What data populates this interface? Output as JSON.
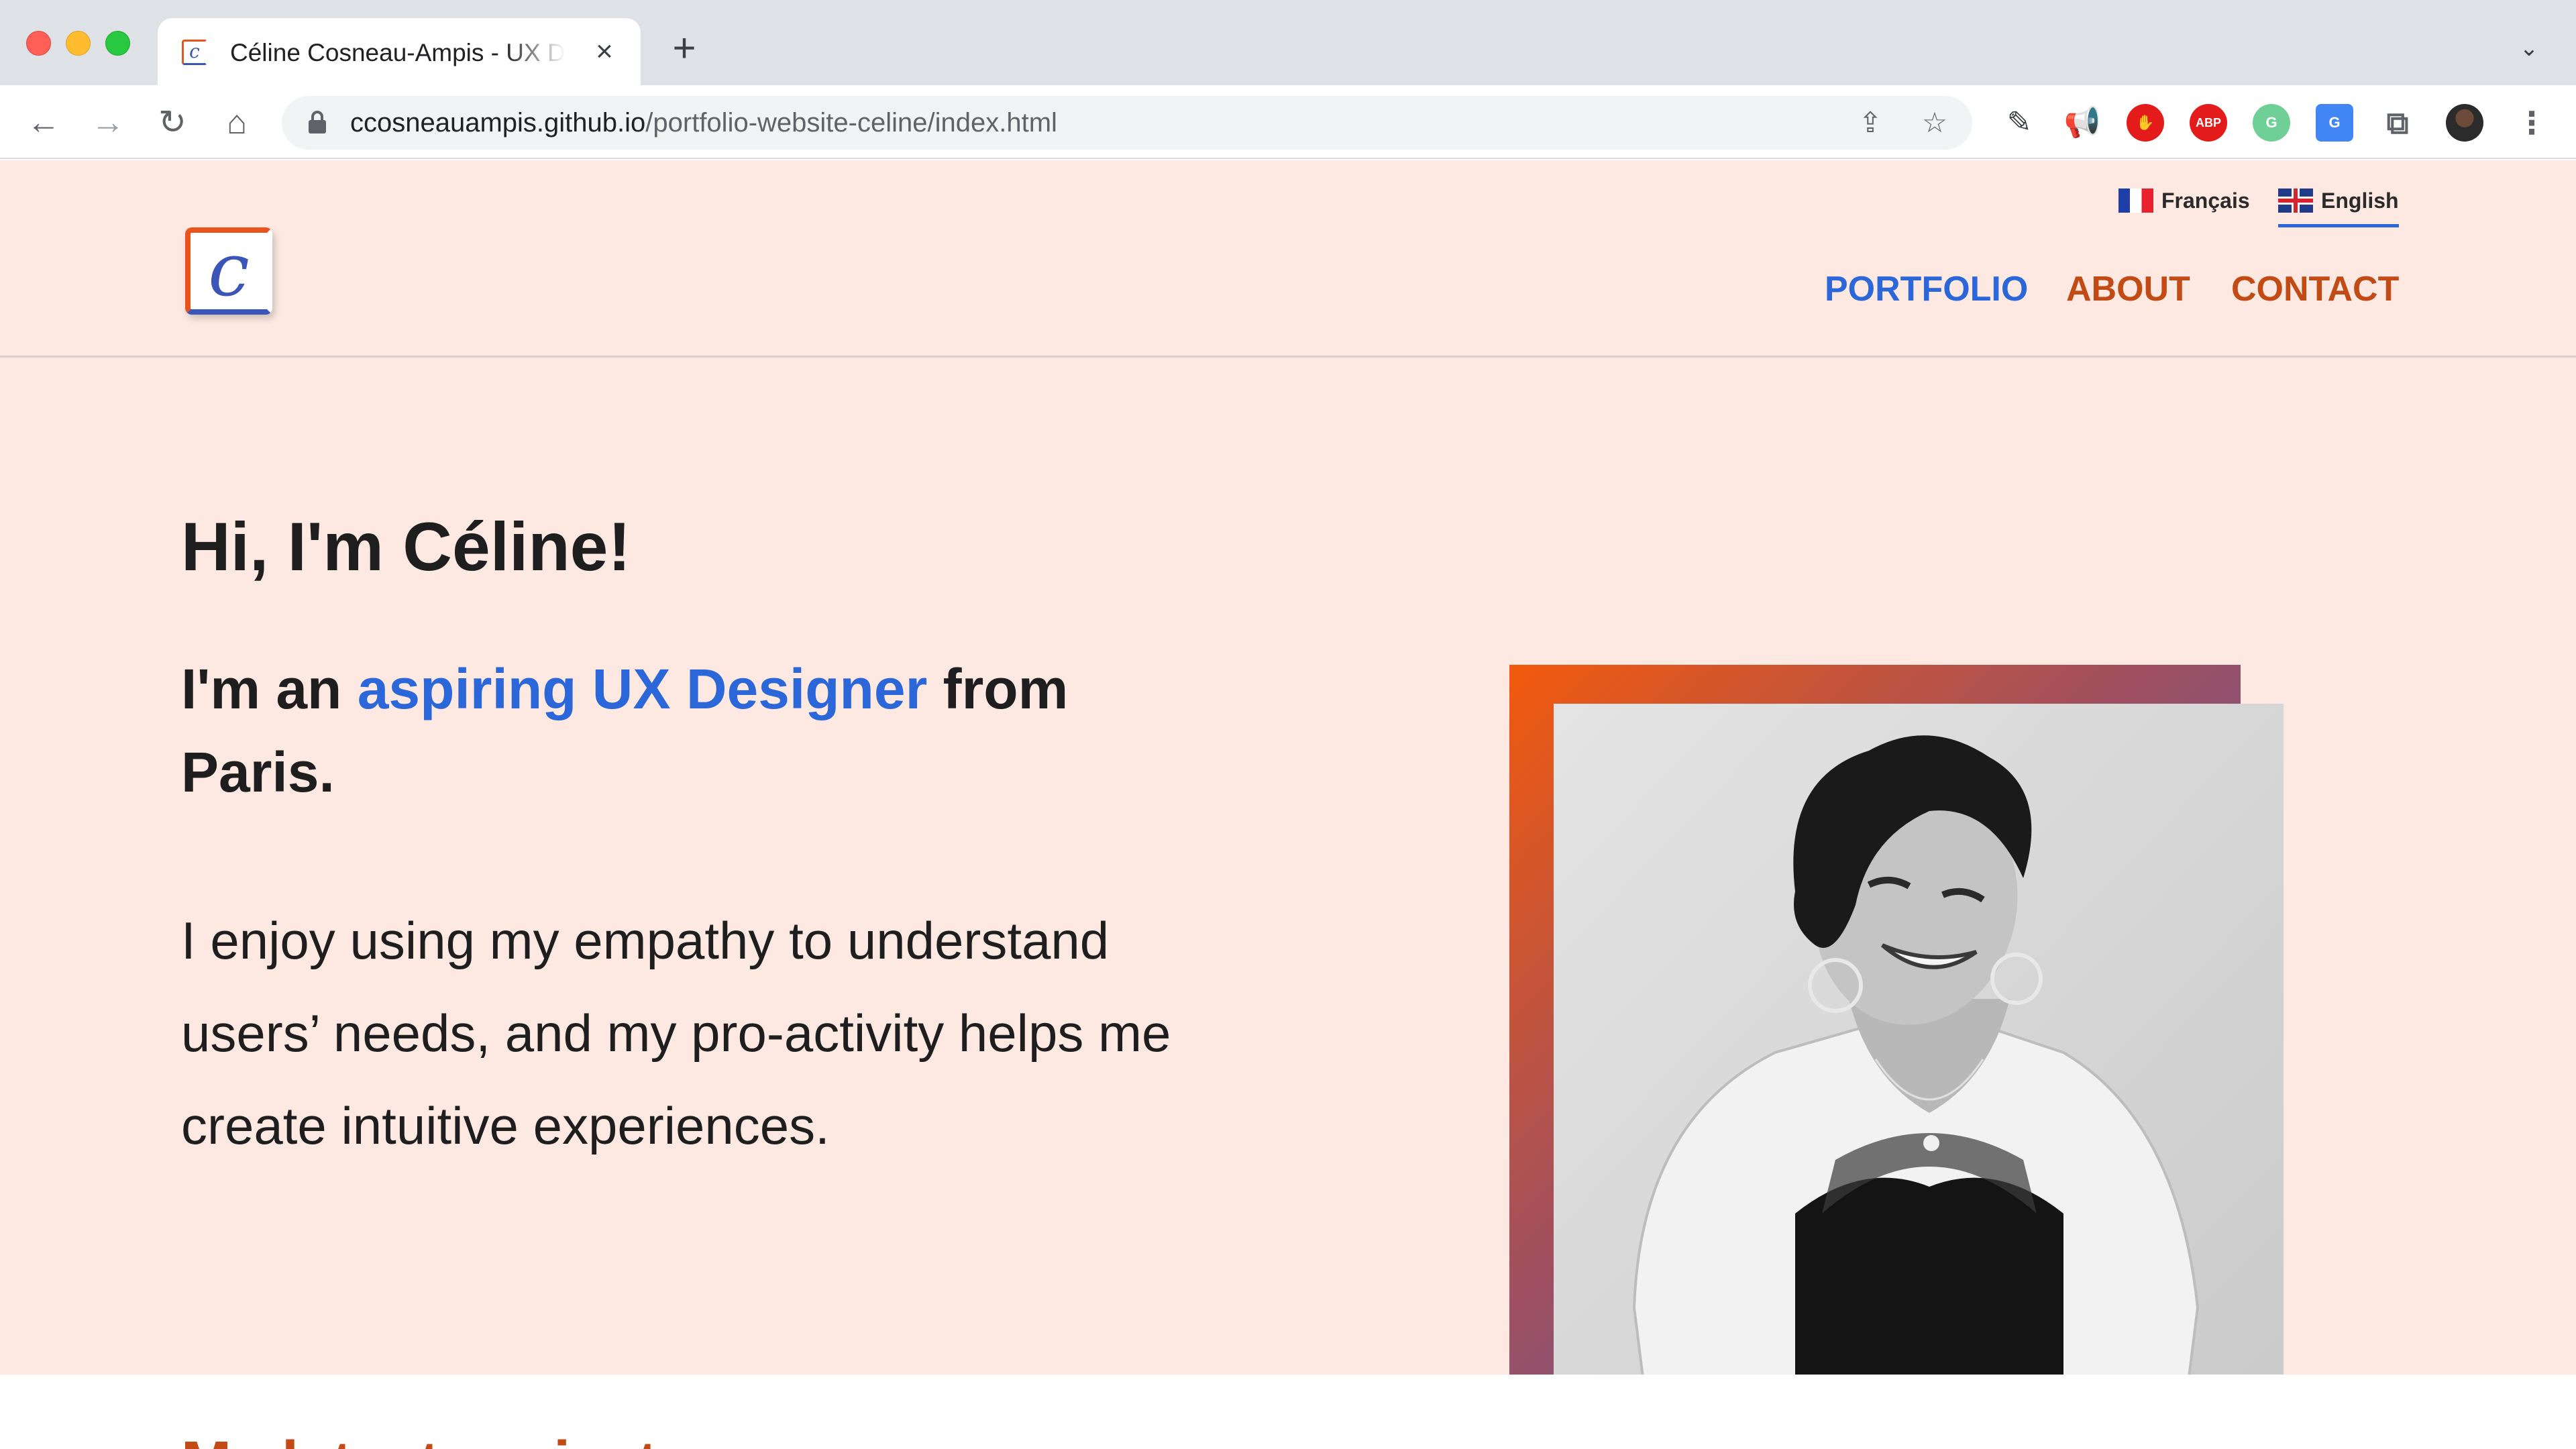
{
  "browser": {
    "tab": {
      "title": "Céline Cosneau-Ampis - UX Designer",
      "favicon_letter": "c"
    },
    "url": {
      "host": "ccosneauampis.github.io",
      "path": "/portfolio-website-celine/index.html"
    },
    "icons": {
      "close": "×",
      "new_tab": "+",
      "tab_menu": "⌄",
      "back": "←",
      "forward": "→",
      "reload": "↻",
      "home": "⌂",
      "share": "⇪",
      "star": "☆",
      "ext_picker": "✎",
      "ext_megaphone": "📢",
      "ext_stop": "✋",
      "ext_abp": "ABP",
      "ext_grammar": "G",
      "ext_translate": "G",
      "ext_puzzle": "⧉",
      "menu": "⋮"
    }
  },
  "site": {
    "logo_letter": "c",
    "languages": [
      {
        "label": "Français",
        "flag": "fr-flag-icon",
        "active": false
      },
      {
        "label": "English",
        "flag": "uk-flag-icon",
        "active": true
      }
    ],
    "nav": {
      "portfolio": "PORTFOLIO",
      "about": "ABOUT",
      "contact": "CONTACT"
    },
    "colors": {
      "background": "#fde9e1",
      "accent_blue": "#2b67d8",
      "accent_orange": "#c24a14"
    }
  },
  "hero": {
    "title": "Hi, I'm Céline!",
    "sub_prefix": "I'm an ",
    "sub_accent": "aspiring UX Designer",
    "sub_suffix": " from Paris.",
    "body": "I enjoy using my empathy to understand users’ needs, and my pro-activity helps me create intuitive experiences."
  },
  "next_section": {
    "heading": "My latest projects"
  }
}
